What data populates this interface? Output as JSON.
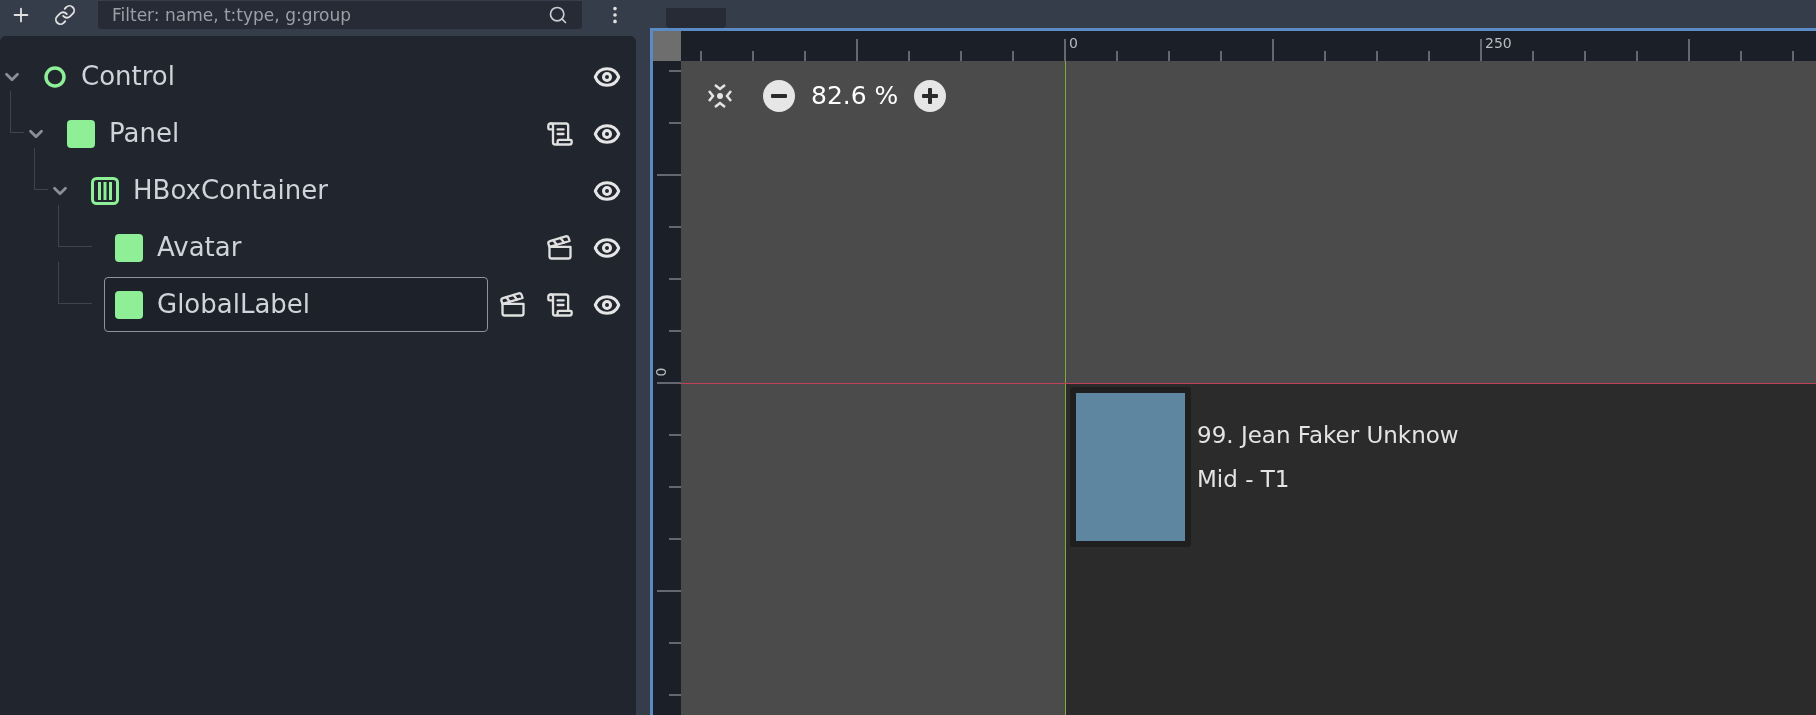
{
  "scene_filter": {
    "placeholder": "Filter: name, t:type, g:group"
  },
  "tree": [
    {
      "name": "Control",
      "kind": "control",
      "expanded": true,
      "selected": false,
      "visible": true,
      "has_scene": false,
      "has_script": false,
      "children": [
        {
          "name": "Panel",
          "kind": "panel",
          "expanded": true,
          "selected": false,
          "visible": true,
          "has_scene": false,
          "has_script": true,
          "children": [
            {
              "name": "HBoxContainer",
              "kind": "hbox",
              "expanded": true,
              "selected": false,
              "visible": true,
              "has_scene": false,
              "has_script": false,
              "children": [
                {
                  "name": "Avatar",
                  "kind": "panel",
                  "selected": false,
                  "visible": true,
                  "has_scene": true,
                  "has_script": false
                },
                {
                  "name": "GlobalLabel",
                  "kind": "panel",
                  "selected": true,
                  "visible": true,
                  "has_scene": true,
                  "has_script": true
                }
              ]
            }
          ]
        }
      ]
    }
  ],
  "zoom": {
    "reading": "82.6 %"
  },
  "rulers": {
    "x_labels": [
      "0",
      "250"
    ],
    "y_labels": [
      "0"
    ]
  },
  "card": {
    "lines": [
      "99. Jean Faker Unknow",
      "Mid - T1"
    ]
  }
}
